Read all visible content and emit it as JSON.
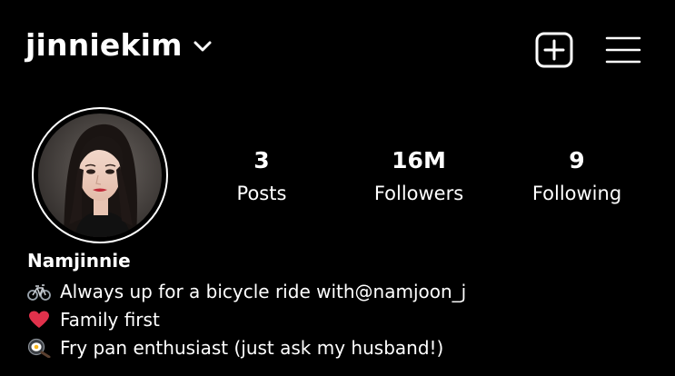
{
  "header": {
    "username": "jinniekim",
    "dropdown_icon": "chevron-down-icon",
    "add_icon": "plus-square-icon",
    "menu_icon": "hamburger-menu-icon"
  },
  "profile": {
    "avatar_icon": "profile-photo",
    "stats": {
      "posts": {
        "value": "3",
        "label": "Posts"
      },
      "followers": {
        "value": "16M",
        "label": "Followers"
      },
      "following": {
        "value": "9",
        "label": "Following"
      }
    },
    "display_name": "Namjinnie",
    "bio": {
      "line1": {
        "icon": "bicycle-emoji",
        "text_before": "Always up for a bicycle ride with ",
        "mention": "@namjoon_j"
      },
      "line2": {
        "icon": "red-heart-emoji",
        "text": "Family first"
      },
      "line3": {
        "icon": "frying-pan-emoji",
        "text": "Fry pan enthusiast (just ask my husband!)"
      }
    }
  },
  "colors": {
    "background": "#000000",
    "text": "#ffffff",
    "heart": "#e0314b"
  }
}
